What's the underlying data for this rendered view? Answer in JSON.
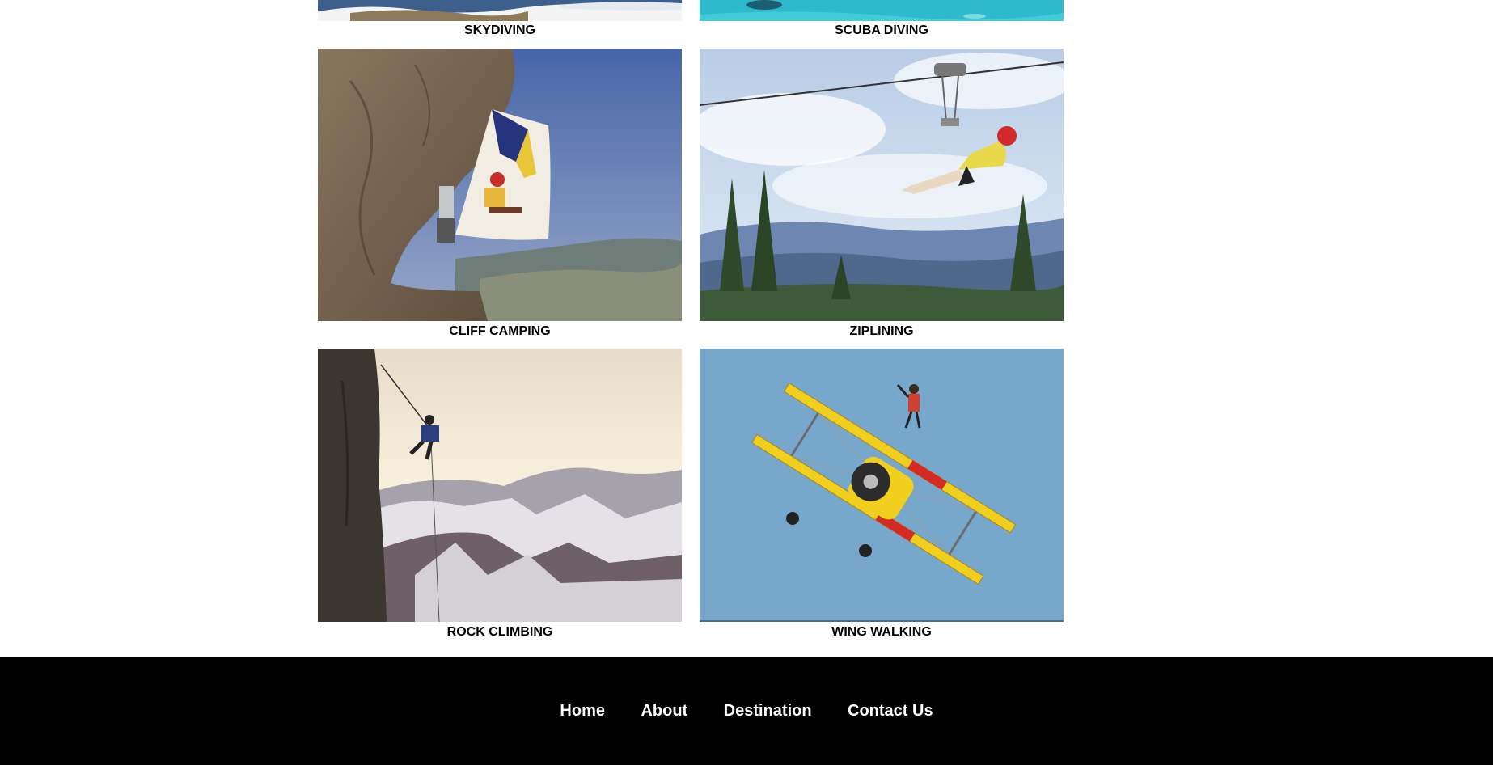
{
  "gallery": {
    "items": [
      {
        "caption": "SKYDIVING"
      },
      {
        "caption": "SCUBA DIVING"
      },
      {
        "caption": "CLIFF CAMPING"
      },
      {
        "caption": "ZIPLINING"
      },
      {
        "caption": "ROCK CLIMBING"
      },
      {
        "caption": "WING WALKING"
      }
    ]
  },
  "footer": {
    "nav": [
      "Home",
      "About",
      "Destination",
      "Contact Us"
    ]
  }
}
